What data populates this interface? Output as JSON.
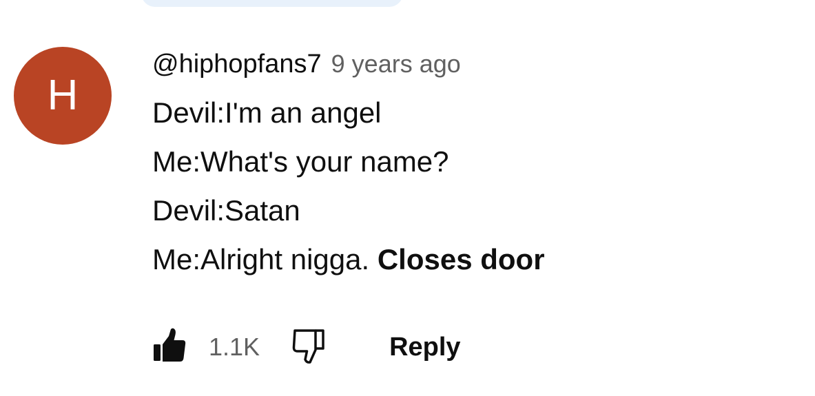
{
  "comment": {
    "avatar_letter": "H",
    "author": "@hiphopfans7",
    "timestamp": "9 years ago",
    "lines": [
      "Devil:I'm an angel",
      "Me:What's your name?",
      "Devil:Satan",
      "Me:Alright nigga."
    ],
    "bold_suffix": "Closes door"
  },
  "actions": {
    "like_icon": "thumbs-up-filled-icon",
    "like_count": "1.1K",
    "dislike_icon": "thumbs-down-outline-icon",
    "reply_label": "Reply"
  },
  "colors": {
    "avatar_bg": "#b94424",
    "secondary_text": "#606060",
    "primary_text": "#0f0f0f",
    "top_pill": "#e8f1fb"
  }
}
